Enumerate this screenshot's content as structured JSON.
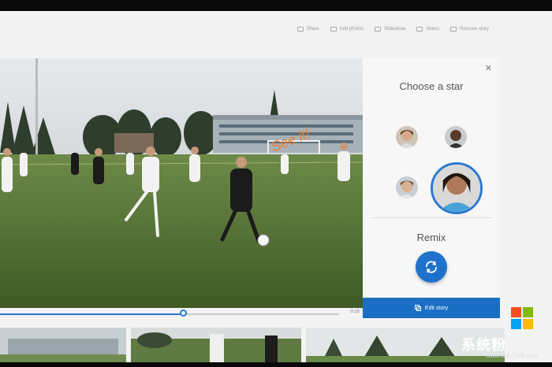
{
  "toolbar": {
    "actions": [
      {
        "label": "Share",
        "icon": "share-icon"
      },
      {
        "label": "Add photos",
        "icon": "add-photos-icon"
      },
      {
        "label": "Slideshow",
        "icon": "slideshow-icon"
      },
      {
        "label": "Select",
        "icon": "select-icon"
      },
      {
        "label": "Remove story",
        "icon": "remove-story-icon"
      }
    ]
  },
  "stage": {
    "ink_annotation": "See it!"
  },
  "panel": {
    "close_icon": "close-icon",
    "title": "Choose a star",
    "remix_label": "Remix",
    "remix_icon": "refresh-icon",
    "edit_label": "Edit story",
    "edit_icon": "edit-story-icon"
  },
  "timeline": {
    "progress": 0.54,
    "time": "0:15"
  },
  "watermark": {
    "text": "系统粉",
    "url": "www.win7999.com"
  },
  "colors": {
    "accent": "#1f72cc",
    "selection": "#2b78d0",
    "ink": "#f07a2c"
  }
}
